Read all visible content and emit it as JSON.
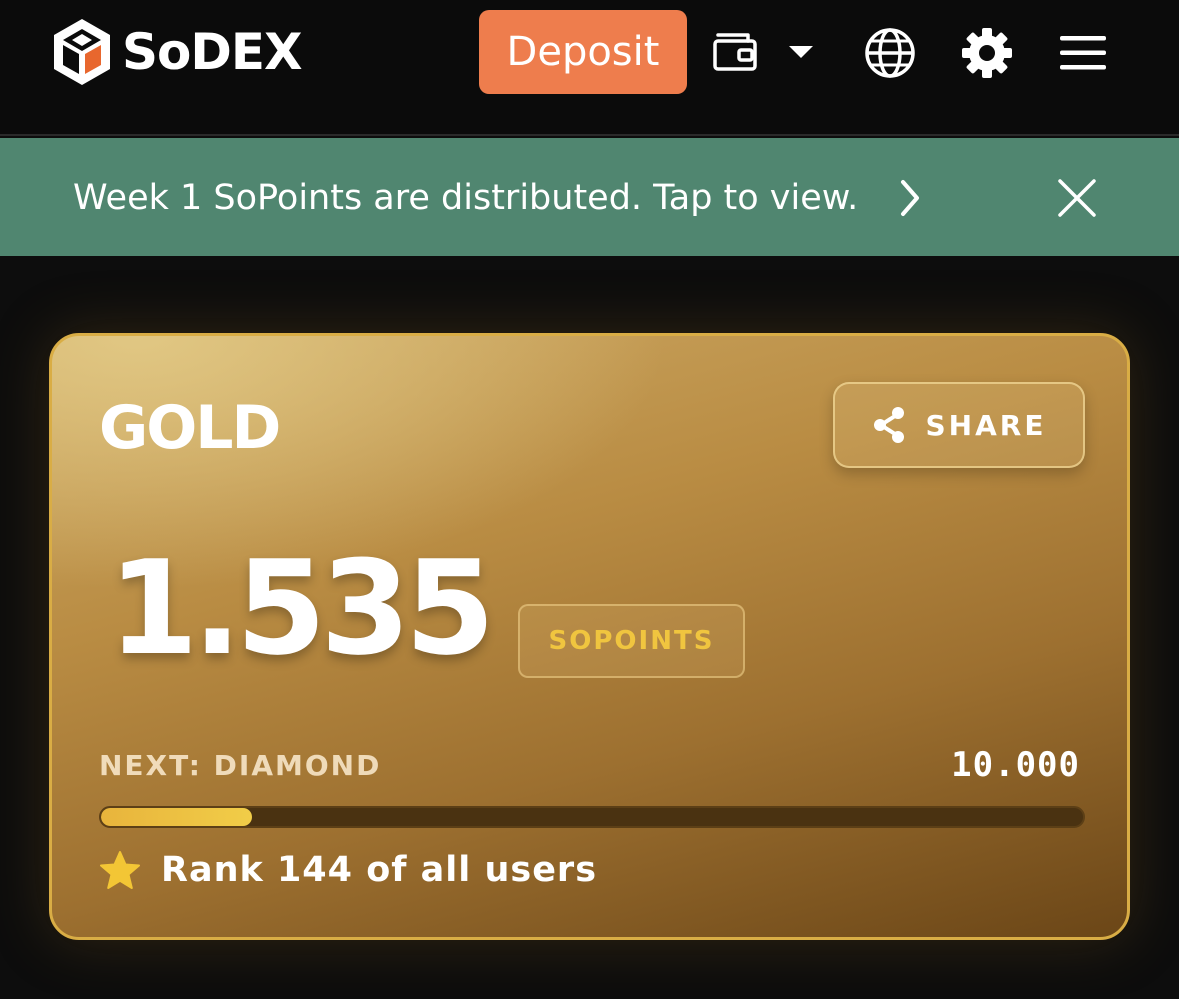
{
  "header": {
    "brand": "SoDEX",
    "deposit_label": "Deposit",
    "icons": [
      "logo-cube-icon",
      "wallet-icon",
      "caret-down-icon",
      "globe-icon",
      "gear-icon",
      "hamburger-menu-icon"
    ]
  },
  "banner": {
    "text": "Week 1 SoPoints are distributed. Tap to view.",
    "icons": [
      "chevron-right-icon",
      "close-icon"
    ]
  },
  "card": {
    "tier": "GOLD",
    "share_label": "SHARE",
    "points": "1.535",
    "unit": "SOPOINTS",
    "next_label": "NEXT: DIAMOND",
    "next_target": "10.000",
    "progress_fraction": 0.1535,
    "rank_text": "Rank 144 of all users",
    "icons": [
      "share-icon",
      "star-icon"
    ]
  },
  "colors": {
    "accent_orange": "#ee7d4d",
    "banner_green": "#508670",
    "gold_border": "#d9ad45",
    "sopoints_yellow": "#f0c53f",
    "progress_yellow": "#f1cd48",
    "background": "#0d0d0d"
  }
}
